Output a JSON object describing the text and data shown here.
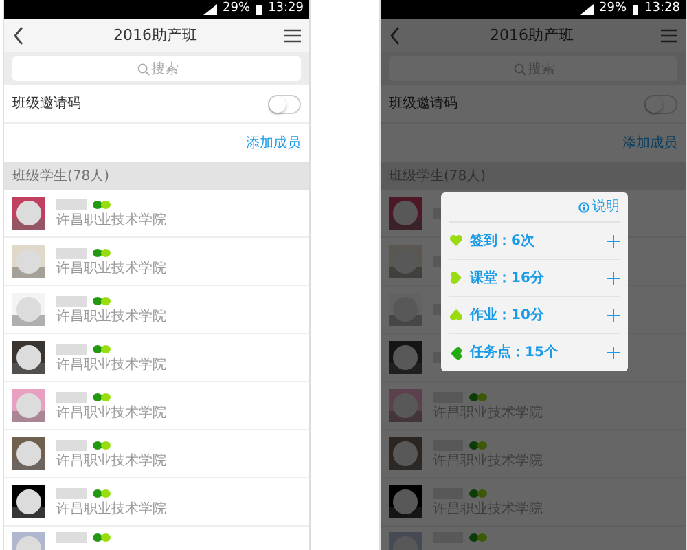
{
  "screens": [
    {
      "status": {
        "battery": "29%",
        "time": "13:29"
      },
      "title": "2016助产班",
      "search": {
        "placeholder": "搜索"
      },
      "invite": {
        "label": "班级邀请码",
        "on": false
      },
      "add_member": "添加成员",
      "section": "班级学生(78人)",
      "students": [
        {
          "kind": "full",
          "school": "许昌职业技术学院"
        },
        {
          "kind": "full",
          "school": "许昌职业技术学院"
        },
        {
          "kind": "full",
          "school": "许昌职业技术学院"
        },
        {
          "kind": "full",
          "school": "许昌职业技术学院"
        },
        {
          "kind": "full",
          "school": "许昌职业技术学院"
        },
        {
          "kind": "full",
          "school": "许昌职业技术学院"
        },
        {
          "kind": "full",
          "school": "许昌职业技术学院"
        },
        {
          "kind": "cut"
        }
      ]
    },
    {
      "status": {
        "battery": "29%",
        "time": "13:28"
      },
      "title": "2016助产班",
      "search": {
        "placeholder": "搜索"
      },
      "invite": {
        "label": "班级邀请码",
        "on": false
      },
      "add_member": "添加成员",
      "section": "班级学生(78人)",
      "students": [
        {
          "kind": "covered"
        },
        {
          "kind": "covered"
        },
        {
          "kind": "covered"
        },
        {
          "kind": "covered"
        },
        {
          "kind": "full",
          "school": "许昌职业技术学院"
        },
        {
          "kind": "full",
          "school": "许昌职业技术学院"
        },
        {
          "kind": "full",
          "school": "许昌职业技术学院"
        },
        {
          "kind": "cut"
        }
      ],
      "popup": {
        "help": "说明",
        "items": [
          {
            "label": "签到：6次",
            "color": "#99dd11",
            "kind": "heart"
          },
          {
            "label": "课堂：16分",
            "color": "#99dd11",
            "kind": "left"
          },
          {
            "label": "作业：10分",
            "color": "#99dd11",
            "kind": "up"
          },
          {
            "label": "任务点：15个",
            "color": "#22aa11",
            "kind": "right"
          }
        ]
      }
    }
  ]
}
